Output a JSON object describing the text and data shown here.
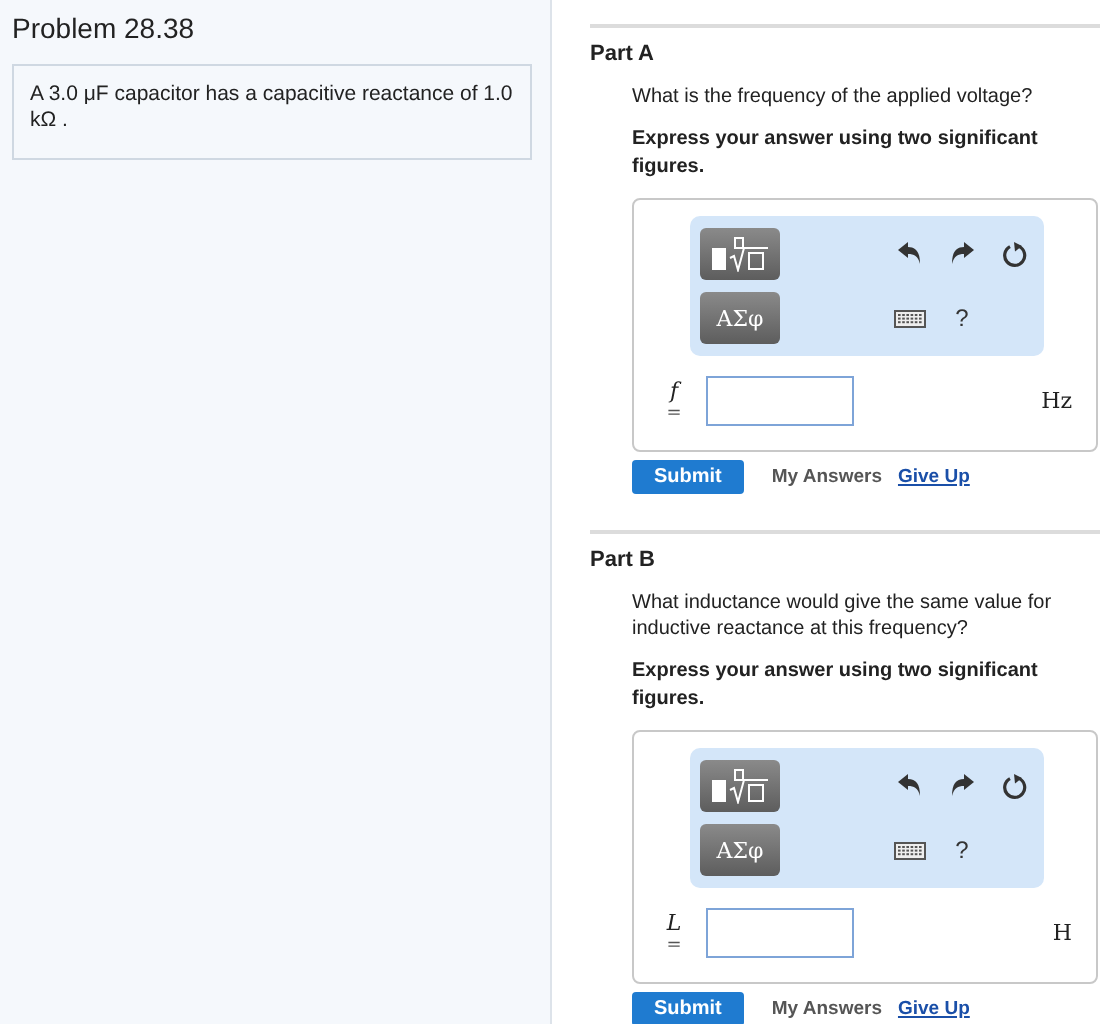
{
  "problem": {
    "title": "Problem 28.38",
    "statement": "A 3.0 μF capacitor has a capacitive reactance of 1.0 kΩ ."
  },
  "parts": [
    {
      "title": "Part A",
      "question": "What is the frequency of the applied voltage?",
      "instruction": "Express your answer using two significant figures.",
      "toolbar": {
        "symbols": "ΑΣφ",
        "help": "?"
      },
      "variable": "f",
      "equals": "=",
      "unit": "Hz",
      "submit": "Submit",
      "my_answers": "My Answers",
      "give_up": "Give Up"
    },
    {
      "title": "Part B",
      "question": "What inductance would give the same value for inductive reactance at this frequency?",
      "instruction": "Express your answer using two significant figures.",
      "toolbar": {
        "symbols": "ΑΣφ",
        "help": "?"
      },
      "variable": "L",
      "equals": "=",
      "unit": "H",
      "submit": "Submit",
      "my_answers": "My Answers",
      "give_up": "Give Up"
    }
  ]
}
